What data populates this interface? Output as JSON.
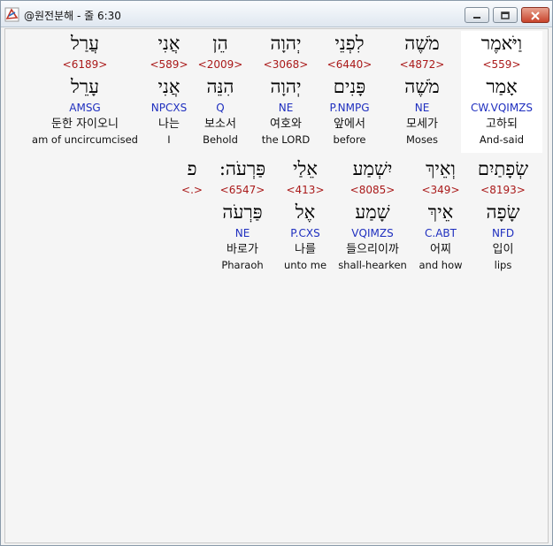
{
  "window": {
    "title": "@원전분해 - 줄 6:30",
    "icon": "app-logo-icon",
    "controls": [
      "minimize-icon",
      "maximize-icon",
      "close-icon"
    ]
  },
  "line1": [
    {
      "heb": "וַיֹּאמֶר",
      "num": "<559>",
      "root": "אָמַר",
      "code": "CW.VQIMZS",
      "kor": "고하되",
      "eng": "And-said",
      "selected": true
    },
    {
      "heb": "מֹשֶׁה",
      "num": "<4872>",
      "root": "מֹשֶׁה",
      "code": "NE",
      "kor": "모세가",
      "eng": "Moses"
    },
    {
      "heb": "לִפְנֵי",
      "num": "<6440>",
      "root": "פָּנִים",
      "code": "P.NMPG",
      "kor": "앞에서",
      "eng": "before"
    },
    {
      "heb": "יְהוָה",
      "num": "<3068>",
      "root": "יְהוָה",
      "code": "NE",
      "kor": "여호와",
      "eng": "the LORD"
    },
    {
      "heb": "הֵן",
      "num": "<2009>",
      "root": "הִנֵּה",
      "code": "Q",
      "kor": "보소서",
      "eng": "Behold"
    },
    {
      "heb": "אֲנִי",
      "num": "<589>",
      "root": "אֲנִי",
      "code": "NPCXS",
      "kor": "나는",
      "eng": "I"
    },
    {
      "heb": "עֲרַל",
      "num": "<6189>",
      "root": "עָרֵל",
      "code": "AMSG",
      "kor": "둔한 자이오니",
      "eng": "am of uncircumcised"
    }
  ],
  "line2": [
    {
      "heb": "שְׂפָתַיִם",
      "num": "<8193>",
      "root": "שָׂפָה",
      "code": "NFD",
      "kor": "입이",
      "eng": "lips"
    },
    {
      "heb": "וְאֵיךְ",
      "num": "<349>",
      "root": "אֵיךְ",
      "code": "C.ABT",
      "kor": "어찌",
      "eng": "and how"
    },
    {
      "heb": "יִשְׁמַע",
      "num": "<8085>",
      "root": "שָׁמַע",
      "code": "VQIMZS",
      "kor": "들으리이까",
      "eng": "shall-hearken"
    },
    {
      "heb": "אֵלַי",
      "num": "<413>",
      "root": "אֶל",
      "code": "P.CXS",
      "kor": "나를",
      "eng": "unto me"
    },
    {
      "heb": "פַּרְעֹה:",
      "num": "<6547>",
      "root": "פַּרְעֹה",
      "code": "NE",
      "kor": "바로가",
      "eng": "Pharaoh"
    },
    {
      "heb": "פ",
      "num": "<.>",
      "root": "",
      "code": "",
      "kor": "",
      "eng": ""
    }
  ]
}
